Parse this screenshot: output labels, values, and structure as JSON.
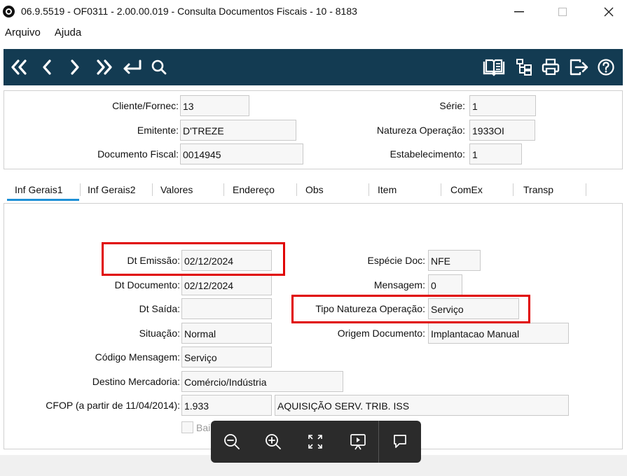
{
  "window": {
    "title": "06.9.5519 - OF0311 - 2.00.00.019 - Consulta Documentos Fiscais - 10 - 8183",
    "minimize": "—",
    "maximize": "☐",
    "close": "✕"
  },
  "menu": [
    "Arquivo",
    "Ajuda"
  ],
  "toolbar": {
    "left_icons": [
      "first-record-icon",
      "previous-record-icon",
      "next-record-icon",
      "last-record-icon",
      "return-icon",
      "search-icon"
    ],
    "right_icons": [
      "manual-book-icon",
      "tree-structure-icon",
      "print-icon",
      "exit-icon",
      "help-icon"
    ],
    "background": "#133b52"
  },
  "header": {
    "cliente_fornec": {
      "label": "Cliente/Fornec:",
      "value": "13"
    },
    "emitente": {
      "label": "Emitente:",
      "value": "D'TREZE"
    },
    "documento_fiscal": {
      "label": "Documento Fiscal:",
      "value": "0014945"
    },
    "serie": {
      "label": "Série:",
      "value": "1"
    },
    "natureza_operacao": {
      "label": "Natureza Operação:",
      "value": "1933OI"
    },
    "estabelecimento": {
      "label": "Estabelecimento:",
      "value": "1"
    }
  },
  "tabs": [
    "Inf Gerais1",
    "Inf Gerais2",
    "Valores",
    "Endereço",
    "Obs",
    "Item",
    "ComEx",
    "Transp"
  ],
  "active_tab": "Inf Gerais1",
  "form": {
    "dt_emissao": {
      "label": "Dt Emissão:",
      "value": "02/12/2024"
    },
    "dt_documento": {
      "label": "Dt Documento:",
      "value": "02/12/2024"
    },
    "dt_saida": {
      "label": "Dt Saída:",
      "value": ""
    },
    "situacao": {
      "label": "Situação:",
      "value": "Normal"
    },
    "codigo_mensagem": {
      "label": "Código Mensagem:",
      "value": "Serviço"
    },
    "destino_mercadoria": {
      "label": "Destino Mercadoria:",
      "value": "Comércio/Indústria"
    },
    "cfop": {
      "label": "CFOP (a partir de 11/04/2014):",
      "code": "1.933",
      "description": "AQUISIÇÃO SERV. TRIB. ISS"
    },
    "especie_doc": {
      "label": "Espécie Doc:",
      "value": "NFE"
    },
    "mensagem": {
      "label": "Mensagem:",
      "value": "0"
    },
    "tipo_natureza_operacao": {
      "label": "Tipo Natureza Operação:",
      "value": "Serviço"
    },
    "origem_documento": {
      "label": "Origem Documento:",
      "value": "Implantacao Manual"
    },
    "baixa_checkbox": {
      "label": "Bai",
      "checked": false
    }
  },
  "highlight_color": "#e00000",
  "viewer_overlay": {
    "buttons": [
      "zoom-out-icon",
      "zoom-in-icon",
      "fit-screen-icon",
      "slideshow-icon",
      "comment-icon"
    ]
  }
}
